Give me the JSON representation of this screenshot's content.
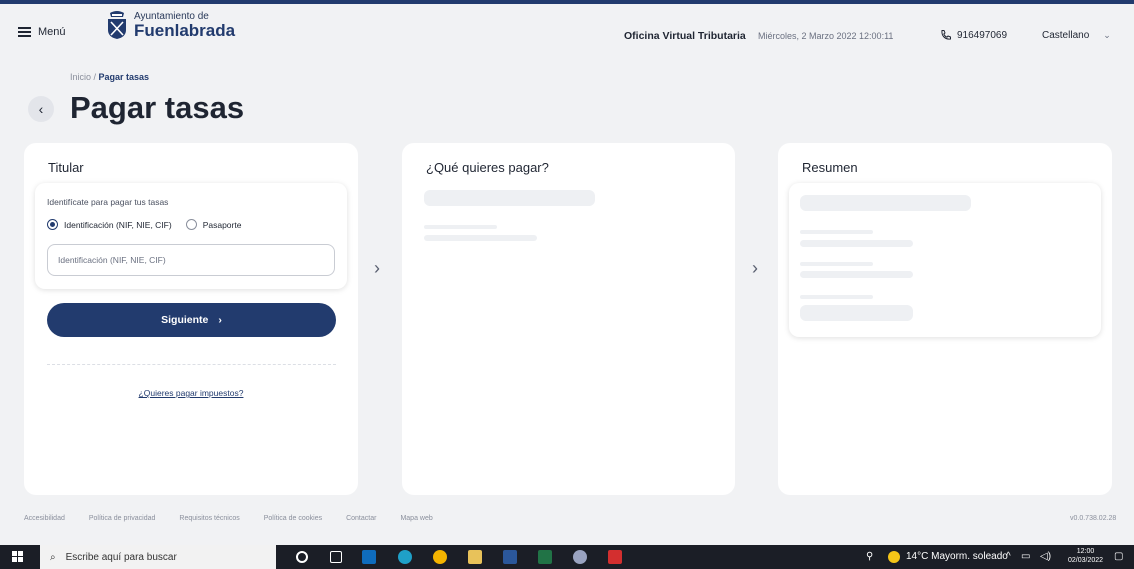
{
  "header": {
    "menu_label": "Menú",
    "logo_line1": "Ayuntamiento de",
    "logo_line2": "Fuenlabrada",
    "office": "Oficina Virtual Tributaria",
    "datetime": "Miércoles, 2 Marzo 2022 12:00:11",
    "phone": "916497069",
    "language": "Castellano"
  },
  "breadcrumb": {
    "home": "Inicio",
    "separator": " / ",
    "current": "Pagar tasas"
  },
  "page_title": "Pagar tasas",
  "titular": {
    "title": "Titular",
    "hint": "Identifícate para pagar tus tasas",
    "options": [
      "Identificación (NIF, NIE, CIF)",
      "Pasaporte"
    ],
    "selected_option": "Identificación (NIF, NIE, CIF)",
    "input_placeholder": "Identificación (NIF, NIE, CIF)",
    "input_value": "",
    "next_label": "Siguiente",
    "taxes_link": "¿Quieres pagar impuestos?"
  },
  "what_to_pay": {
    "title": "¿Qué quieres pagar?"
  },
  "summary": {
    "title": "Resumen"
  },
  "footer": {
    "links": [
      "Accesibilidad",
      "Política de privacidad",
      "Requisitos técnicos",
      "Política de cookies",
      "Contactar",
      "Mapa web"
    ],
    "version": "v0.0.738.02.28"
  },
  "taskbar": {
    "search_placeholder": "Escribe aquí para buscar",
    "weather": "14°C  Mayorm. soleado",
    "time": "12:00",
    "date": "02/03/2022"
  },
  "colors": {
    "primary": "#223b6e",
    "background": "#f1f2f4",
    "card": "#ffffff",
    "skeleton": "#eef0f3"
  }
}
